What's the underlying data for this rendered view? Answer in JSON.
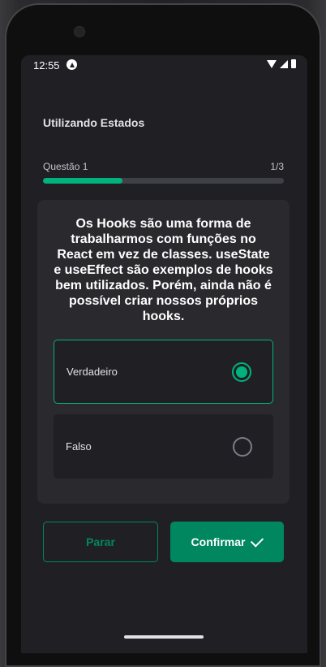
{
  "status": {
    "time": "12:55"
  },
  "header": {
    "title": "Utilizando Estados"
  },
  "progress": {
    "label": "Questão 1",
    "count": "1/3",
    "fraction": 0.33
  },
  "question": {
    "text": "Os Hooks são uma forma de trabalharmos com funções no React em vez de classes. useState e useEffect são exemplos de hooks bem utilizados. Porém, ainda não é possível criar nossos próprios hooks."
  },
  "options": [
    {
      "label": "Verdadeiro",
      "selected": true
    },
    {
      "label": "Falso",
      "selected": false
    }
  ],
  "actions": {
    "stop_label": "Parar",
    "confirm_label": "Confirmar"
  },
  "colors": {
    "accent": "#00b37e",
    "button": "#00875f",
    "background": "#202024",
    "card": "#29292e"
  }
}
